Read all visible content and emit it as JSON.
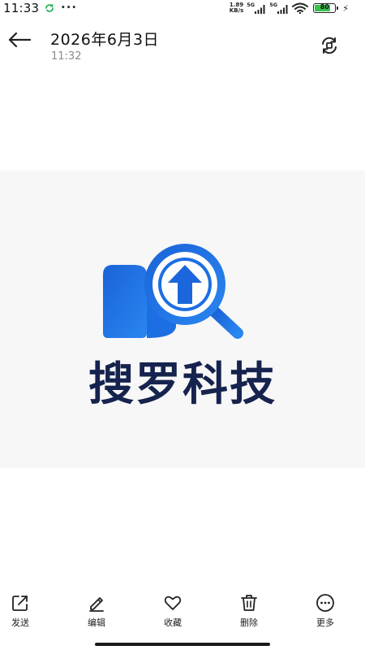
{
  "status_bar": {
    "time": "11:33",
    "more": "···",
    "speed_value": "1.89",
    "speed_unit": "KB/s",
    "net1": "5G",
    "net2": "5G",
    "battery": "80",
    "battery_level": 0.8,
    "icons": [
      "sync-icon",
      "signal-icon",
      "wifi-icon",
      "battery-icon",
      "charging-icon"
    ]
  },
  "header": {
    "title": "2026年6月3日",
    "subtitle": "11:32",
    "icons": [
      "back-arrow-icon",
      "rotate-icon"
    ]
  },
  "image": {
    "brand_text": "搜罗科技",
    "colors": {
      "brand_blue": "#1e6fe0",
      "text_navy": "#16234e"
    }
  },
  "toolbar": {
    "items": [
      {
        "label": "发送",
        "icon": "share-icon"
      },
      {
        "label": "编辑",
        "icon": "edit-icon"
      },
      {
        "label": "收藏",
        "icon": "heart-icon"
      },
      {
        "label": "删除",
        "icon": "trash-icon"
      },
      {
        "label": "更多",
        "icon": "more-icon"
      }
    ]
  }
}
